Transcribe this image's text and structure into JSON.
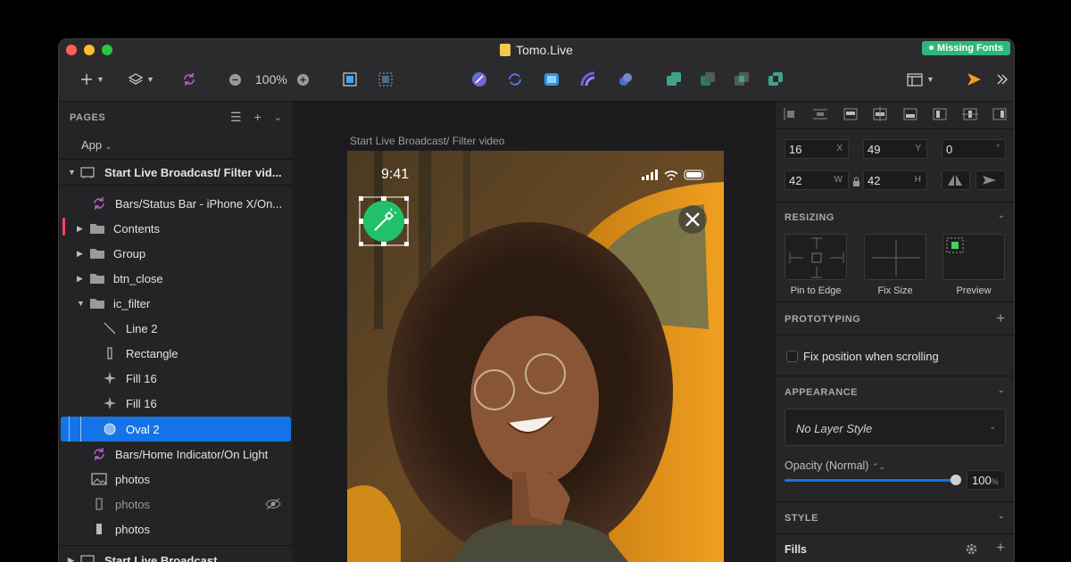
{
  "window": {
    "title": "Tomo.Live",
    "badge": "Missing Fonts"
  },
  "toolbar": {
    "zoom": "100%",
    "zoom_out": "−",
    "zoom_in": "+"
  },
  "pages": {
    "header": "PAGES",
    "current_page": "App",
    "layers": [
      {
        "label": "Start Live Broadcast/ Filter vid...",
        "icon": "artboard-icon"
      },
      {
        "label": "Bars/Status Bar - iPhone X/On...",
        "icon": "symbol-icon"
      },
      {
        "label": "Contents",
        "icon": "folder-icon"
      },
      {
        "label": "Group",
        "icon": "folder-icon"
      },
      {
        "label": "btn_close",
        "icon": "folder-icon"
      },
      {
        "label": "ic_filter",
        "icon": "folder-icon"
      },
      {
        "label": "Line 2",
        "icon": "line-icon"
      },
      {
        "label": "Rectangle",
        "icon": "rectangle-icon"
      },
      {
        "label": "Fill 16",
        "icon": "star-icon"
      },
      {
        "label": "Fill 16",
        "icon": "star-icon"
      },
      {
        "label": "Oval 2",
        "icon": "oval-icon"
      },
      {
        "label": "Bars/Home Indicator/On Light",
        "icon": "symbol-icon"
      },
      {
        "label": "photos",
        "icon": "image-icon"
      },
      {
        "label": "photos",
        "icon": "rectangle-icon"
      },
      {
        "label": "photos",
        "icon": "rectangle-icon"
      },
      {
        "label": "Start Live Broadcast",
        "icon": "artboard-icon"
      }
    ]
  },
  "canvas": {
    "artboard_name": "Start Live Broadcast/ Filter video",
    "status_time": "9:41"
  },
  "inspector": {
    "x": "16",
    "x_unit": "X",
    "y": "49",
    "y_unit": "Y",
    "rotation": "0",
    "rotation_unit": "°",
    "w": "42",
    "w_unit": "W",
    "h": "42",
    "h_unit": "H",
    "resizing": {
      "title": "RESIZING",
      "pin_to_edge": "Pin to Edge",
      "fix_size": "Fix Size",
      "preview": "Preview"
    },
    "prototyping": {
      "title": "PROTOTYPING",
      "fix_position": "Fix position when scrolling",
      "fix_position_checked": false
    },
    "appearance": {
      "title": "APPEARANCE",
      "layer_style": "No Layer Style",
      "opacity_label": "Opacity (Normal)",
      "opacity": "100",
      "opacity_unit": "%",
      "opacity_fraction": 1.0
    },
    "style": {
      "title": "STYLE",
      "fills": "Fills"
    }
  },
  "colors": {
    "accent": "#1473e6",
    "filter_button": "#22c06a",
    "badge": "#2fb67c"
  }
}
